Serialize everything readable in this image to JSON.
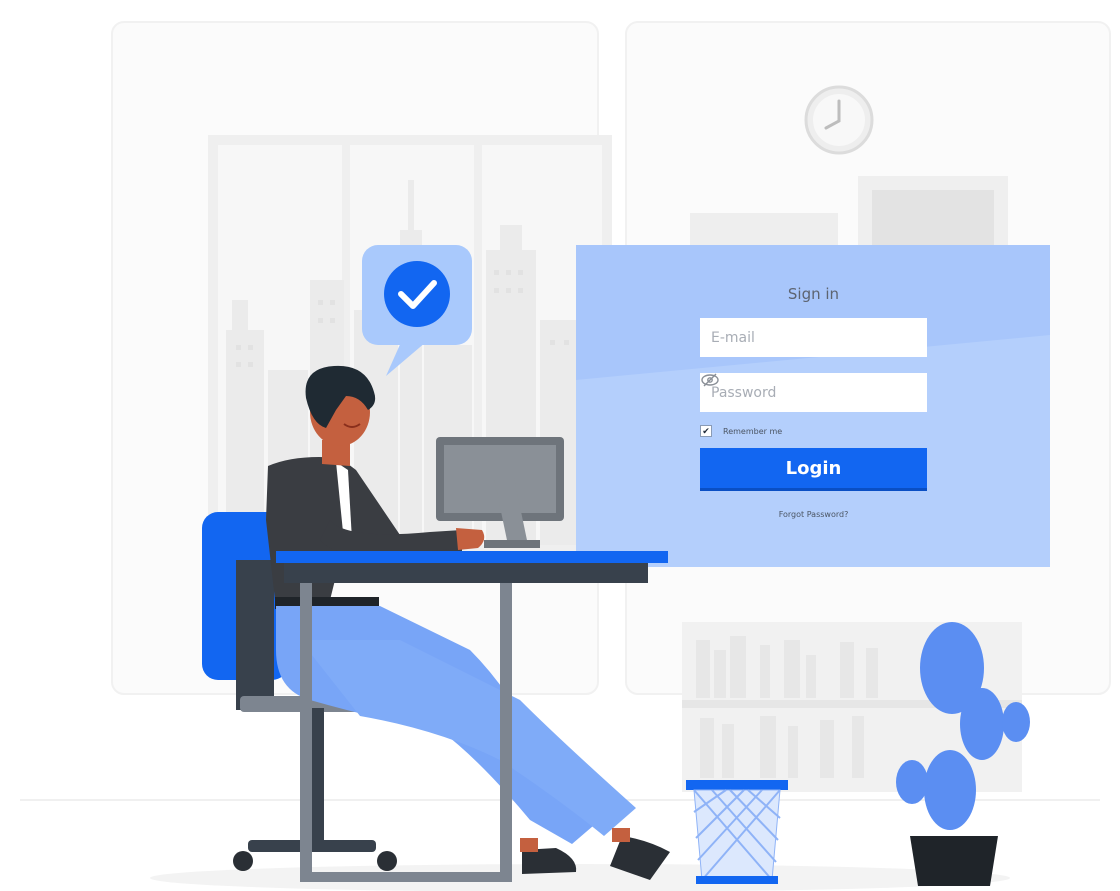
{
  "colors": {
    "accent": "#1266f1",
    "panel": "#a8c6fb",
    "skin": "#c4603f",
    "hair": "#1f2a33",
    "shirt": "#3a3d42",
    "pants": "#78a5f7",
    "cactus": "#5b8ef2",
    "bubble": "#a9c9fc"
  },
  "icons": [
    "check-icon",
    "clock-icon",
    "eye-slash-icon",
    "checkbox-check-icon"
  ],
  "signin": {
    "title": "Sign in",
    "email_placeholder": "E-mail",
    "password_placeholder": "Password",
    "remember_label": "Remember me",
    "remember_checked": true,
    "remember_mark": "✔",
    "login_label": "Login",
    "forgot_label": "Forgot Password?"
  }
}
